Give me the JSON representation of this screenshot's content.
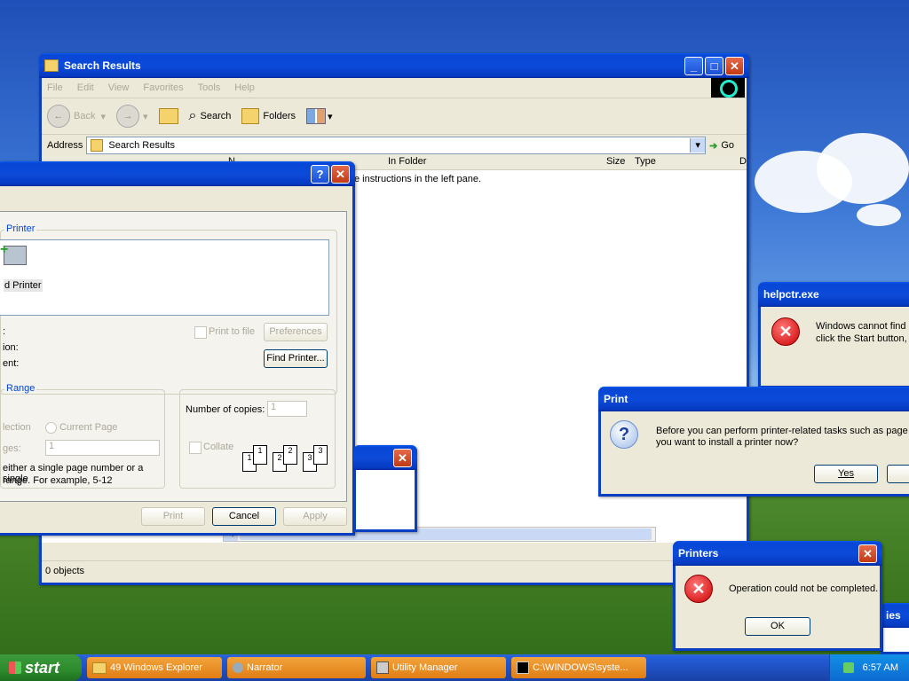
{
  "explorer": {
    "title": "Search Results",
    "menu": [
      "File",
      "Edit",
      "View",
      "Favorites",
      "Tools",
      "Help"
    ],
    "back_label": "Back",
    "search_label": "Search",
    "folders_label": "Folders",
    "address_label": "Address",
    "address_value": "Search Results",
    "go_label": "Go",
    "columns": [
      "N",
      "In Folder",
      "Size",
      "Type",
      "D"
    ],
    "body_text": "e instructions in the left pane.",
    "status": "0 objects"
  },
  "print_dialog": {
    "help_glyph": "?",
    "printer_group": "Printer",
    "add_printer_label": "d Printer",
    "field_labels": [
      ":",
      "ion:",
      "ent:"
    ],
    "print_to_file": "Print to file",
    "preferences": "Preferences",
    "find_printer": "Find Printer...",
    "range_group": "Range",
    "selection": "lection",
    "current_page": "Current Page",
    "pages": "ges:",
    "pages_value": "1",
    "range_hint_1": "either a single page number or a single",
    "range_hint_2": "range.  For example, 5-12",
    "copies_label": "Number of copies:",
    "copies_value": "1",
    "collate": "Collate",
    "print": "Print",
    "cancel": "Cancel",
    "apply": "Apply"
  },
  "helpctr": {
    "title": "helpctr.exe",
    "line1": "Windows cannot find '",
    "line2": "click the Start button, a"
  },
  "print_prompt": {
    "title": "Print",
    "line1": "Before you can perform printer-related tasks such as page se",
    "line2": "you want to install a printer now?",
    "yes": "Yes"
  },
  "printers": {
    "title": "Printers",
    "message": "Operation could not be completed.",
    "ok": "OK",
    "behind_title": "ies"
  },
  "taskbar": {
    "start": "start",
    "tasks": [
      "49 Windows Explorer",
      "Narrator",
      "Utility Manager",
      "C:\\WINDOWS\\syste..."
    ],
    "clock": "6:57 AM"
  }
}
